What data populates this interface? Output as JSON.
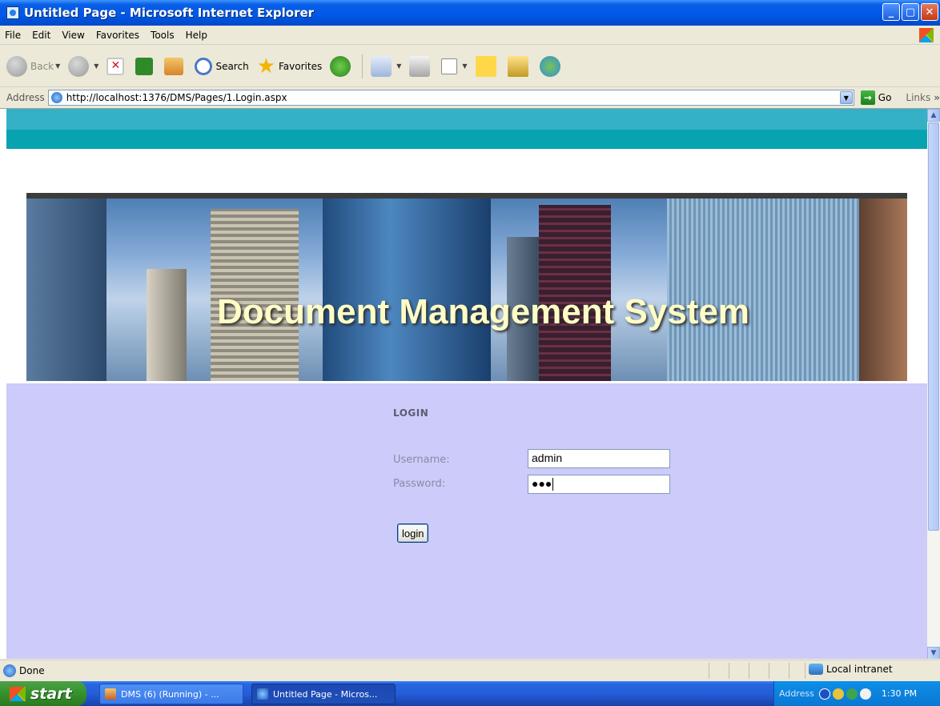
{
  "window": {
    "title": "Untitled Page - Microsoft Internet Explorer",
    "controls": [
      "minimize",
      "maximize",
      "close"
    ]
  },
  "menu": {
    "items": [
      "File",
      "Edit",
      "View",
      "Favorites",
      "Tools",
      "Help"
    ]
  },
  "toolbar": {
    "back": "Back",
    "search": "Search",
    "favorites": "Favorites"
  },
  "address_bar": {
    "label": "Address",
    "url": "http://localhost:1376/DMS/Pages/1.Login.aspx",
    "go": "Go",
    "links": "Links",
    "chevron": "»"
  },
  "page": {
    "banner_title": "Document Management System",
    "login": {
      "title": "LOGIN",
      "username_label": "Username:",
      "password_label": "Password:",
      "username_value": "admin",
      "password_mask": "●●●",
      "button_label": "login"
    },
    "colors": {
      "teal_top": "#34b1c5",
      "teal_bottom": "#07a3b0",
      "login_bg": "#cccbfa",
      "banner_text": "#fffcc6"
    }
  },
  "status_bar": {
    "text": "Done",
    "zone": "Local intranet"
  },
  "taskbar": {
    "start": "start",
    "tasks": [
      {
        "label": "DMS (6) (Running) - ...",
        "icon": "visual-studio-icon",
        "active": false
      },
      {
        "label": "Untitled Page - Micros...",
        "icon": "ie-icon",
        "active": true
      }
    ],
    "tray_label": "Address",
    "clock": "1:30 PM"
  }
}
